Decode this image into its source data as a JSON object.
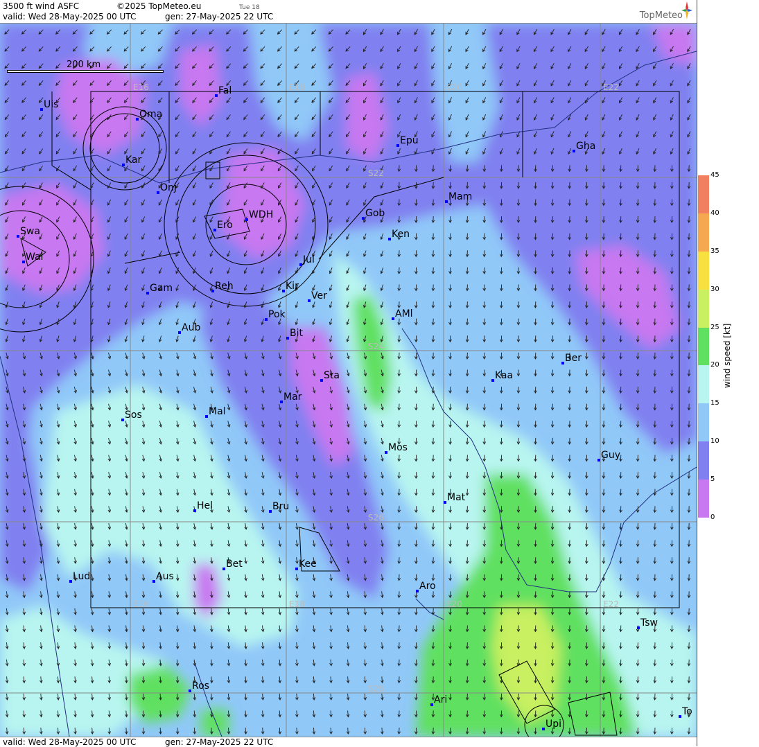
{
  "header": {
    "product": "3500 ft wind ASFC",
    "copyright": "©2025 TopMeteo.eu",
    "day_tag": "Tue 18",
    "valid": "valid:  Wed  28-May-2025  00 UTC",
    "generated": "gen: 27-May-2025 22 UTC",
    "brand": "TopMeteo"
  },
  "footer": {
    "valid": "valid:  Wed  28-May-2025  00 UTC",
    "generated": "gen: 27-May-2025 22 UTC"
  },
  "scale_bar": {
    "label": "200 km"
  },
  "legend": {
    "title": "wind speed [kt]",
    "ticks": [
      "45",
      "40",
      "35",
      "30",
      "25",
      "20",
      "15",
      "10",
      "5",
      "0"
    ],
    "colors": [
      "#f08060",
      "#f5a850",
      "#f8e040",
      "#c8f060",
      "#60e060",
      "#b8f5f0",
      "#90c8f8",
      "#8080f0",
      "#c878f0"
    ]
  },
  "grid_labels": {
    "lon_top": [
      "E16",
      "E18",
      "E20",
      "E22"
    ],
    "lon_bottom": [
      "E16",
      "E18",
      "E20",
      "E22"
    ],
    "lat": [
      "S22",
      "S24",
      "S26",
      "S28"
    ]
  },
  "places": [
    {
      "code": "Uis"
    },
    {
      "code": "Fal"
    },
    {
      "code": "Oma"
    },
    {
      "code": "Kar"
    },
    {
      "code": "Epu"
    },
    {
      "code": "Gha"
    },
    {
      "code": "Onj"
    },
    {
      "code": "Mam"
    },
    {
      "code": "Gob"
    },
    {
      "code": "WDH"
    },
    {
      "code": "Ero"
    },
    {
      "code": "Swa"
    },
    {
      "code": "Ken"
    },
    {
      "code": "Wal"
    },
    {
      "code": "Jul"
    },
    {
      "code": "Gam"
    },
    {
      "code": "Reh"
    },
    {
      "code": "Kir"
    },
    {
      "code": "Ver"
    },
    {
      "code": "AMl"
    },
    {
      "code": "Pok"
    },
    {
      "code": "Aub"
    },
    {
      "code": "Bit"
    },
    {
      "code": "Ber"
    },
    {
      "code": "Sta"
    },
    {
      "code": "Kaa"
    },
    {
      "code": "Mar"
    },
    {
      "code": "Sos"
    },
    {
      "code": "Mal"
    },
    {
      "code": "Mos"
    },
    {
      "code": "Guy"
    },
    {
      "code": "Mat"
    },
    {
      "code": "Hel"
    },
    {
      "code": "Bru"
    },
    {
      "code": "Bet"
    },
    {
      "code": "Kee"
    },
    {
      "code": "Lud"
    },
    {
      "code": "Aus"
    },
    {
      "code": "Aro"
    },
    {
      "code": "Tsw"
    },
    {
      "code": "Ros"
    },
    {
      "code": "Ari"
    },
    {
      "code": "Upi"
    },
    {
      "code": "To"
    }
  ]
}
